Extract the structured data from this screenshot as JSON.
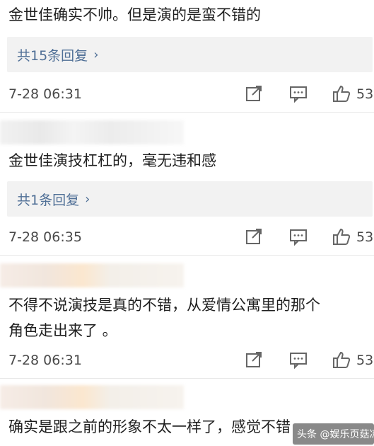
{
  "comments": [
    {
      "text": "金世佳确实不帅。但是演的是蛮不错的",
      "reply": "共15条回复",
      "time": "7-28 06:31",
      "likes": "53"
    },
    {
      "text": "金世佳演技杠杠的，毫无违和感",
      "reply": "共1条回复",
      "time": "7-28 06:35",
      "likes": "53"
    },
    {
      "text_line1": "不得不说演技是真的不错，从爱情公寓里的那个",
      "text_line2": "角色走出来了 。",
      "time": "7-28 06:31",
      "likes": "53"
    },
    {
      "text": "确实是跟之前的形象不太一样了，感觉不错"
    }
  ],
  "watermark": {
    "text": "头条 @娱乐页菇凉"
  },
  "icons": {
    "share": "share-icon",
    "comment": "comment-icon",
    "like": "thumbs-up-icon",
    "reply_arrow": "chevron-right-icon"
  }
}
